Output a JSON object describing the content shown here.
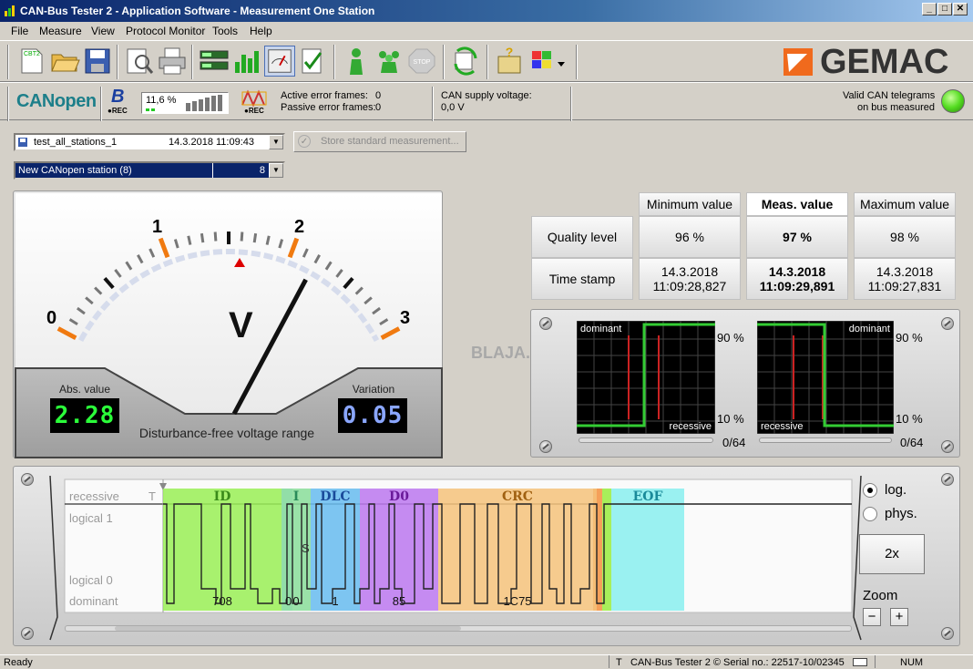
{
  "window": {
    "title": "CAN-Bus Tester 2 - Application Software - Measurement One Station",
    "min": "_",
    "max": "□",
    "close": "✕"
  },
  "menu": [
    "File",
    "Measure",
    "View",
    "Protocol Monitor",
    "Tools",
    "Help"
  ],
  "toolbar": {
    "cbt2_label": "CBT2",
    "stop_label": "STOP"
  },
  "brand": {
    "logo": "GEMAC",
    "logo_color": "#f06a1d"
  },
  "infobar": {
    "canopen": "CANopen",
    "b_icon": "B",
    "rec": "●REC",
    "load_percent": "11,6 %",
    "active_error_label": "Active error frames:",
    "active_error_value": "0",
    "passive_error_label": "Passive error frames:",
    "passive_error_value": "0",
    "supply_label": "CAN supply voltage:",
    "supply_value": "0,0 V",
    "valid_line1": "Valid CAN telegrams",
    "valid_line2": "on bus measured",
    "led_color": "#55dd22"
  },
  "measurement": {
    "name": "test_all_stations_1",
    "datetime": "14.3.2018  11:09:43",
    "store_button": "Store standard measurement...",
    "station": "New CANopen station (8)",
    "station_id": "8"
  },
  "voltmeter": {
    "unit": "V",
    "scale_labels": [
      "0",
      "1",
      "2",
      "3"
    ],
    "needle_value": 2.2,
    "scale_max": 3,
    "abs_label": "Abs. value",
    "abs_value": "2.28",
    "variation_label": "Variation",
    "variation_value": "0.05",
    "range_text": "Disturbance-free voltage range"
  },
  "watermark": "BLAJA.cz",
  "quality_table": {
    "headers": [
      "Minimum value",
      "Meas. value",
      "Maximum value"
    ],
    "rows": [
      {
        "label": "Quality level",
        "values": [
          "96 %",
          "97 %",
          "98 %"
        ]
      },
      {
        "label": "Time stamp",
        "values": [
          "14.3.2018\n11:09:28,827",
          "14.3.2018\n11:09:29,891",
          "14.3.2018\n11:09:27,831"
        ]
      }
    ]
  },
  "scopes": {
    "dominant": "dominant",
    "recessive": "recessive",
    "top_pct": "90 %",
    "bottom_pct": "10 %",
    "count": "0/64"
  },
  "protocol": {
    "recessive": "recessive",
    "t_mark": "T",
    "logical1": "logical 1",
    "logical0": "logical 0",
    "dominant": "dominant",
    "fields": [
      {
        "name": "ID",
        "value": "708",
        "color": "#99ee55"
      },
      {
        "name": "I",
        "value": "0",
        "color": "#88dd99"
      },
      {
        "name": "DLC",
        "value": "1",
        "color": "#66bbee"
      },
      {
        "name": "D0",
        "value": "85",
        "color": "#bb77ee"
      },
      {
        "name": "CRC",
        "value": "1C75",
        "color": "#f5c27a"
      },
      {
        "name": "EOF",
        "value": "",
        "color": "#88eeee"
      }
    ],
    "extra_zero": "0",
    "s_label": "S",
    "log_label": "log.",
    "phys_label": "phys.",
    "zoom_factor": "2x",
    "zoom_label": "Zoom",
    "zoom_minus": "−",
    "zoom_plus": "+"
  },
  "statusbar": {
    "ready": "Ready",
    "t": "T",
    "info": "CAN-Bus Tester 2 © Serial no.: 22517-10/02345",
    "num": "NUM"
  }
}
